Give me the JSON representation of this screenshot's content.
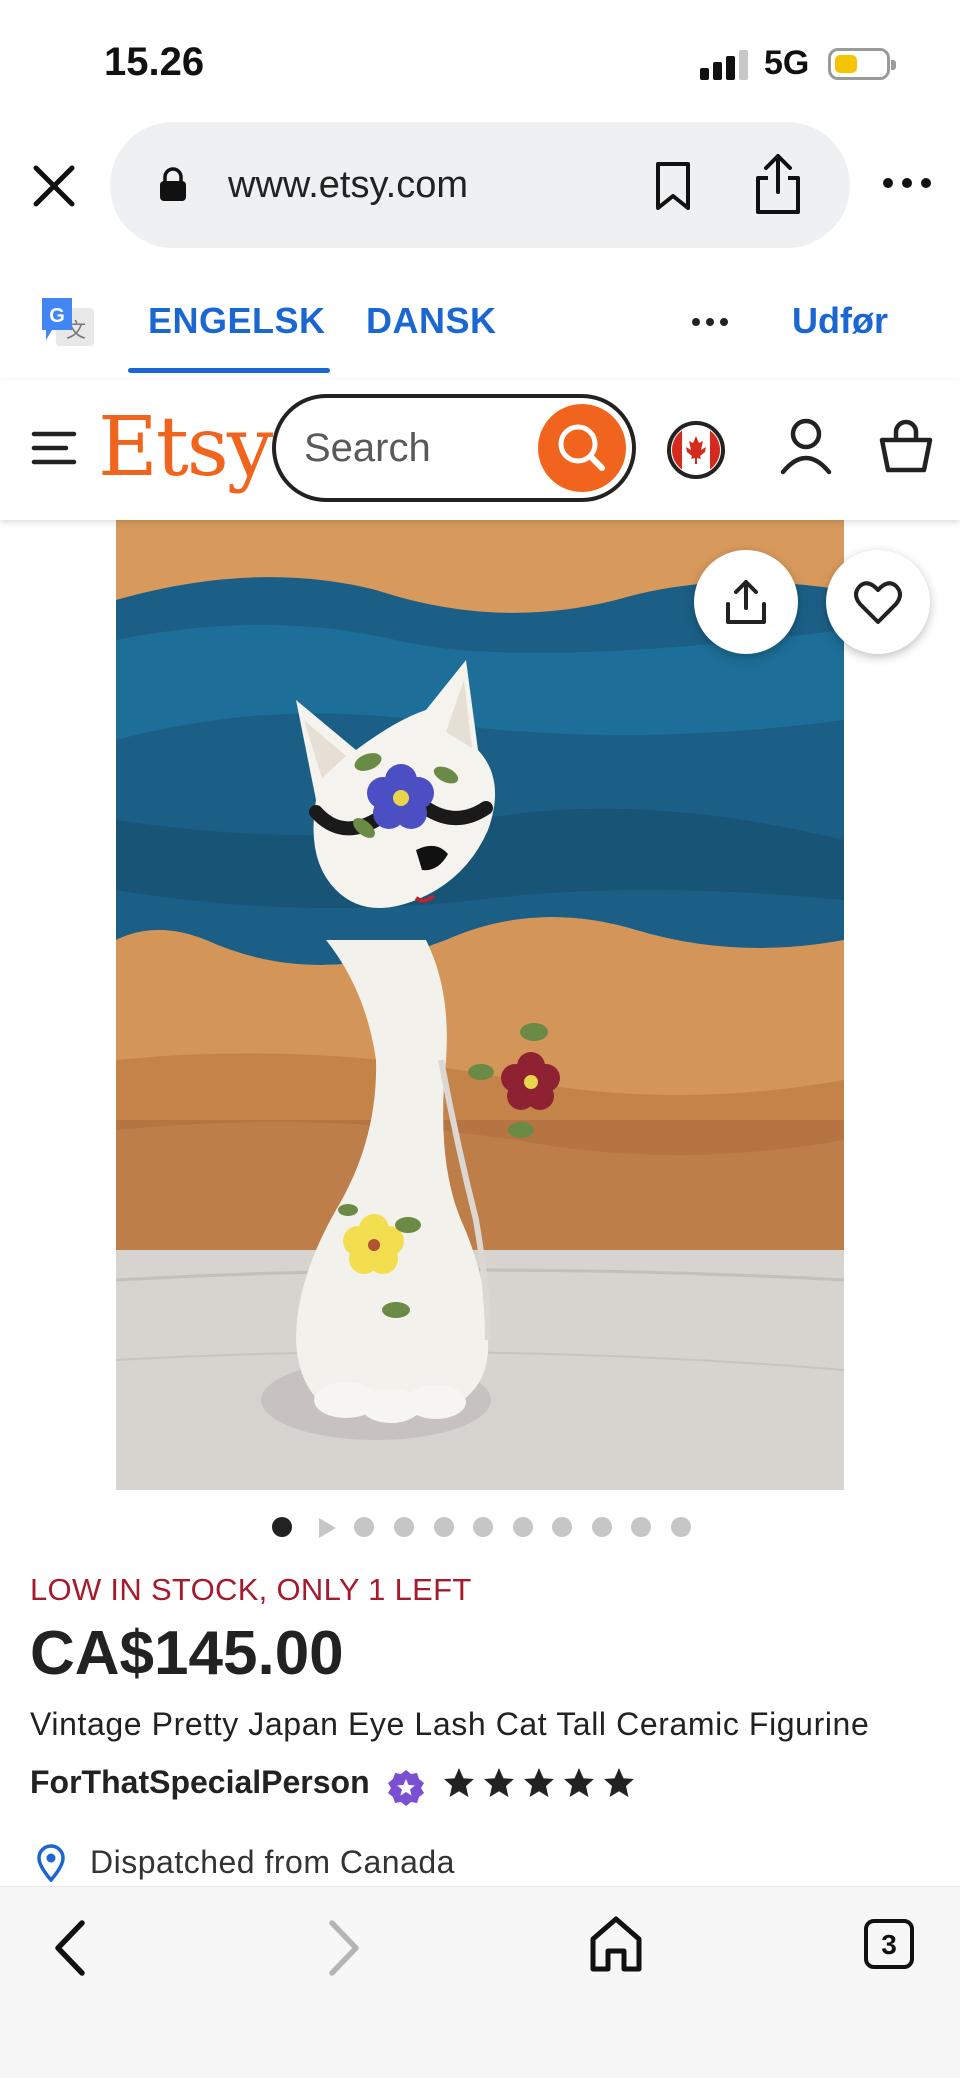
{
  "status_bar": {
    "time": "15.26",
    "network": "5G",
    "battery_level": 0.4,
    "battery_color": "#f5c400",
    "signal_bars": 3
  },
  "browser": {
    "url": "www.etsy.com",
    "icons": [
      "close-icon",
      "lock-icon",
      "bookmark-icon",
      "share-icon",
      "more-icon"
    ]
  },
  "translate_bar": {
    "tabs": [
      {
        "label": "ENGELSK",
        "active": true
      },
      {
        "label": "DANSK",
        "active": false
      }
    ],
    "done_label": "Udfør",
    "accent_color": "#1a66d2"
  },
  "header": {
    "logo": "Etsy",
    "search_placeholder": "Search",
    "brand_color": "#f1641e",
    "icons": [
      "menu-icon",
      "search-icon",
      "canada-flag-icon",
      "account-icon",
      "cart-icon"
    ]
  },
  "product": {
    "image_alt": "Vintage white ceramic cat figurine with painted flowers",
    "carousel": {
      "total": 11,
      "active_index": 0
    },
    "stock_notice": "LOW IN STOCK, ONLY 1 LEFT",
    "price": "CA$145.00",
    "title": "Vintage Pretty Japan Eye Lash Cat Tall Ceramic Figurine",
    "shop_name": "ForThatSpecialPerson",
    "rating_stars": 5,
    "dispatch": "Dispatched from Canada",
    "stock_color": "#a61a2e",
    "star_seller_color": "#7b4fd1"
  },
  "bottom_bar": {
    "tab_count": "3",
    "icons": [
      "back-icon",
      "forward-icon",
      "home-icon",
      "tabs-icon"
    ]
  }
}
